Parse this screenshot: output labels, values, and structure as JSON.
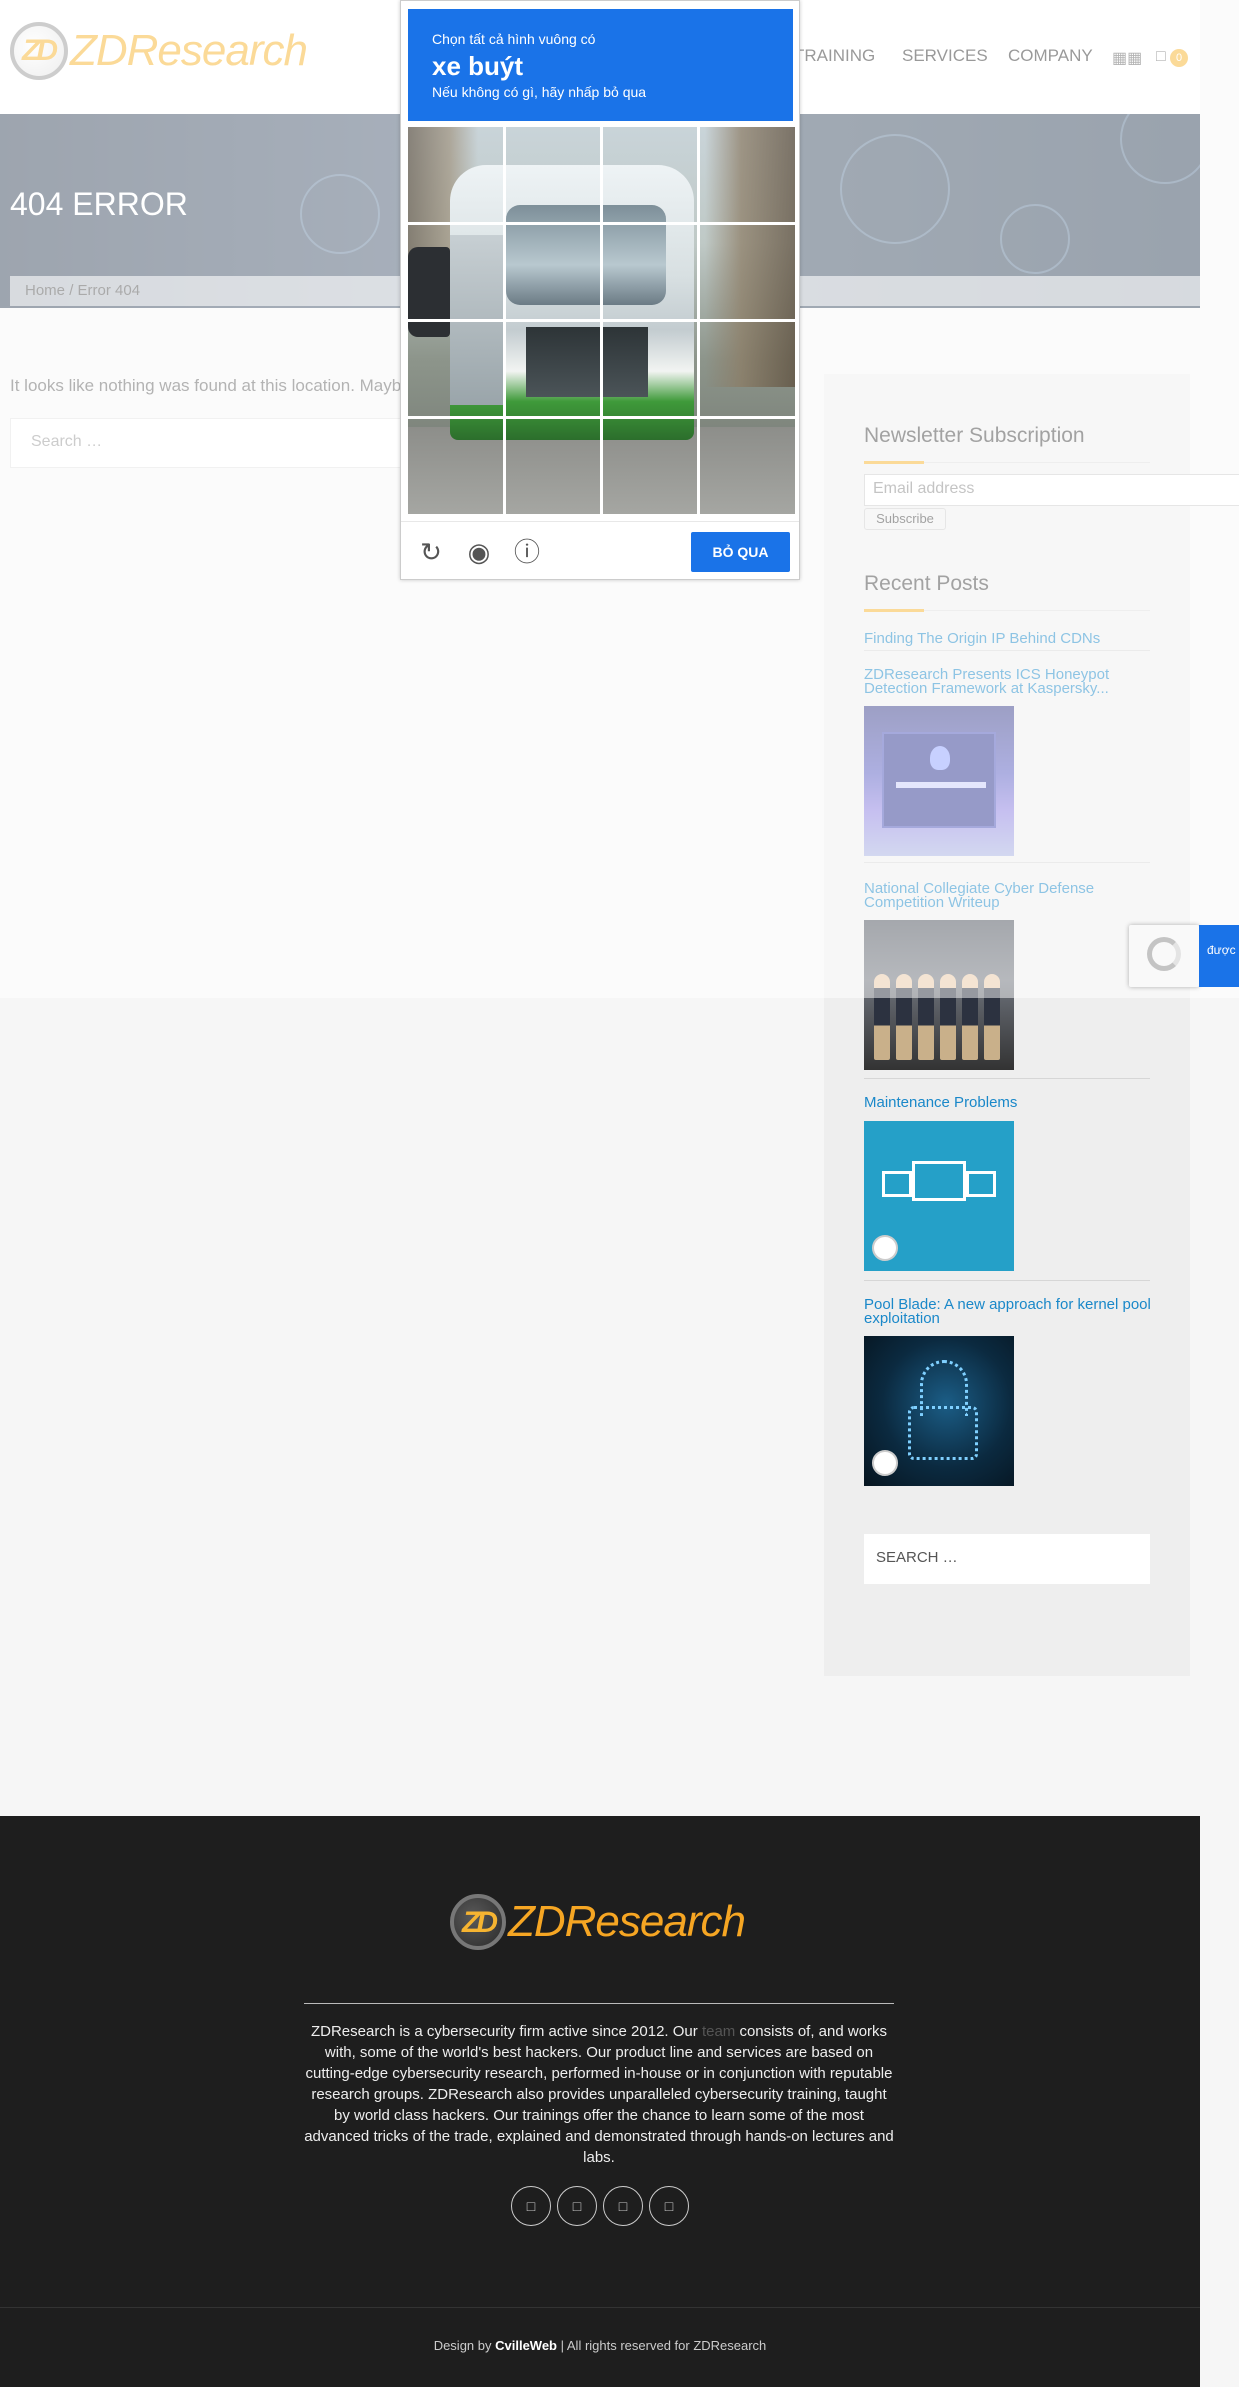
{
  "header": {
    "logo_text": "ZDResearch",
    "logo_mark": "ZD",
    "nav": [
      "TRAINING",
      "SERVICES",
      "COMPANY"
    ],
    "search_icon": "grid-search-icon",
    "cart_icon": "cart-icon",
    "cart_count": "0"
  },
  "hero": {
    "title": "404 ERROR",
    "breadcrumb_home": "Home",
    "breadcrumb_sep": "/",
    "breadcrumb_current": "Error 404"
  },
  "main": {
    "message": "It looks like nothing was found at this location. Mayb",
    "search_placeholder": "Search …"
  },
  "sidebar": {
    "newsletter_title": "Newsletter Subscription",
    "email_placeholder": "Email address",
    "subscribe_label": "Subscribe",
    "recent_title": "Recent Posts",
    "posts": [
      {
        "title": "Finding The Origin IP Behind CDNs"
      },
      {
        "title": "ZDResearch Presents ICS Honeypot Detection Framework at Kaspersky..."
      },
      {
        "title": "National Collegiate Cyber Defense Competition Writeup"
      },
      {
        "title": "Maintenance Problems"
      },
      {
        "title": "Pool Blade: A new approach for kernel pool exploitation"
      }
    ],
    "search_label": "SEARCH …"
  },
  "captcha": {
    "line1": "Chọn tất cả hình vuông có",
    "line2": "xe buýt",
    "line3": "Nếu không có gì, hãy nhấp bỏ qua",
    "skip_label": "BỎ QUA",
    "icons": [
      "reload-icon",
      "audio-icon",
      "info-icon"
    ]
  },
  "recaptcha": {
    "tab_text": "được"
  },
  "footer": {
    "logo_text": "ZDResearch",
    "about_part1": "ZDResearch is a cybersecurity firm active since 2012. Our ",
    "about_link": "team",
    "about_part2": " consists of, and works with, some of the world's best hackers. Our product line and services are based on cutting-edge cybersecurity research, performed in-house or in conjunction with reputable research groups. ZDResearch also provides unparalleled cybersecurity training, taught by world class hackers. Our trainings offer the chance to learn some of the most advanced tricks of the trade, explained and demonstrated through hands-on lectures and labs.",
    "social_icons": [
      "facebook-icon",
      "twitter-icon",
      "linkedin-icon",
      "github-icon"
    ],
    "credit_prefix": "Design by ",
    "credit_name": "CvilleWeb",
    "credit_suffix": " | All rights reserved for ZDResearch"
  },
  "colors": {
    "brand": "#f6b431",
    "link": "#1a88c9",
    "captcha_blue": "#1a73e8",
    "footer_bg": "#1e1e1e"
  }
}
